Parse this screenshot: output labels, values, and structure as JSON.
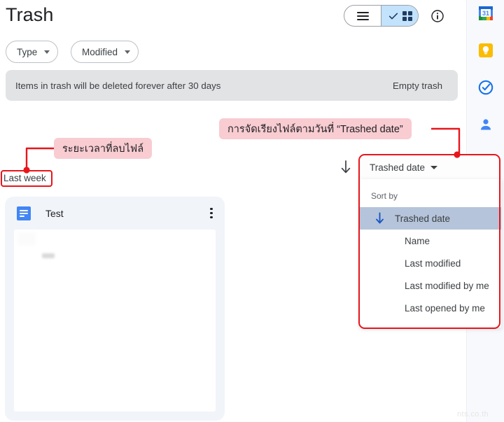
{
  "header": {
    "title": "Trash",
    "view_toggle": {
      "list_icon": "hamburger-list-icon",
      "grid_icon": "grid-view-icon",
      "check_icon": "check-icon",
      "selected": "grid"
    },
    "info_icon": "info-icon"
  },
  "filters": [
    {
      "label": "Type",
      "caret": "chevron-down-icon"
    },
    {
      "label": "Modified",
      "caret": "chevron-down-icon"
    }
  ],
  "banner": {
    "text": "Items in trash will be deleted forever after 30 days",
    "action": "Empty trash"
  },
  "group": {
    "label": "Last week"
  },
  "file_card": {
    "name": "Test",
    "icon": "google-docs-icon",
    "menu_icon": "more-vertical-icon"
  },
  "sort": {
    "direction_icon": "arrow-down-icon",
    "current": "Trashed date",
    "caret": "chevron-down-icon",
    "menu_title": "Sort by",
    "options": [
      {
        "label": "Trashed date",
        "selected": true
      },
      {
        "label": "Name",
        "selected": false
      },
      {
        "label": "Last modified",
        "selected": false
      },
      {
        "label": "Last modified by me",
        "selected": false
      },
      {
        "label": "Last opened by me",
        "selected": false
      }
    ]
  },
  "annotations": {
    "sort_note": "การจัดเรียงไฟล์ตามวันที่ “Trashed date”",
    "duration_note": "ระยะเวลาที่ลบไฟล์",
    "highlight_color": "#e8151b",
    "note_bg": "#f8ccd1"
  },
  "side_rail": {
    "items": [
      {
        "icon": "google-calendar-icon",
        "label": "31"
      },
      {
        "icon": "google-keep-icon",
        "label": ""
      },
      {
        "icon": "google-tasks-icon",
        "label": ""
      },
      {
        "icon": "google-contacts-icon",
        "label": ""
      }
    ]
  },
  "watermark": "nts.co.th"
}
